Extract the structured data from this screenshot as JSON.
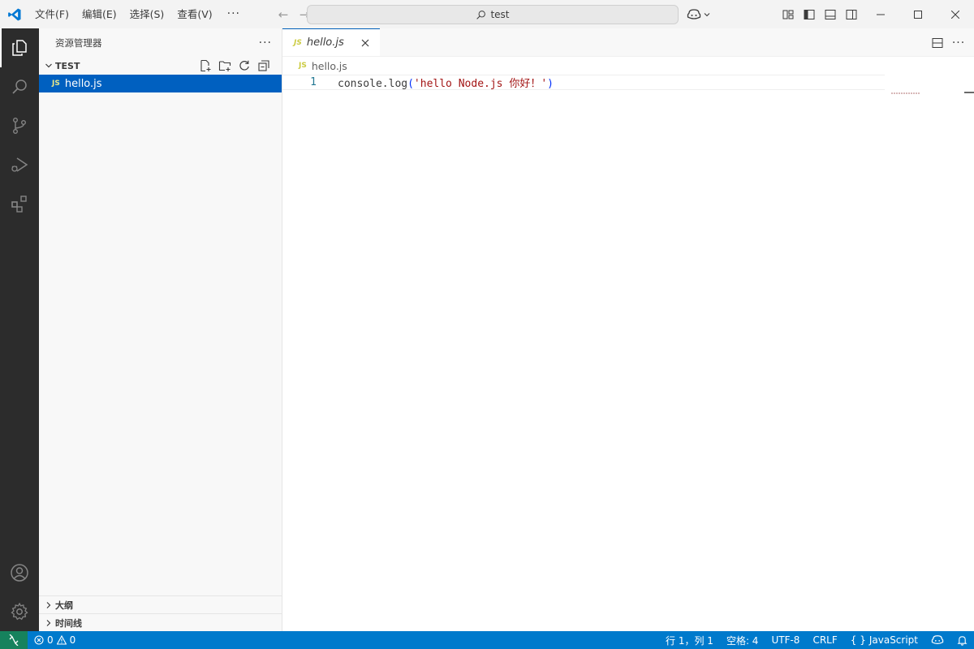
{
  "menu": {
    "file": "文件(F)",
    "edit": "编辑(E)",
    "select": "选择(S)",
    "view": "查看(V)",
    "more": "···"
  },
  "search": {
    "text": "test"
  },
  "sidebar": {
    "title": "资源管理器",
    "more": "···",
    "folder": "TEST",
    "files": [
      {
        "badge": "JS",
        "name": "hello.js"
      }
    ],
    "outline": "大纲",
    "timeline": "时间线"
  },
  "editor": {
    "tab": {
      "badge": "JS",
      "label": "hello.js"
    },
    "breadcrumb": {
      "badge": "JS",
      "label": "hello.js"
    },
    "actions_more": "···",
    "lines": [
      {
        "num": "1",
        "fn": "console.log",
        "open": "(",
        "str": "'hello Node.js 你好！'",
        "close": ")"
      }
    ]
  },
  "status": {
    "errors": "0",
    "warnings": "0",
    "position": "行 1，列 1",
    "spaces": "空格: 4",
    "encoding": "UTF-8",
    "eol": "CRLF",
    "language_prefix": "{ }",
    "language": "JavaScript"
  },
  "colors": {
    "accent": "#007acc",
    "selection": "#0060c0",
    "activity_bar": "#2c2c2c",
    "remote": "#16825d"
  }
}
